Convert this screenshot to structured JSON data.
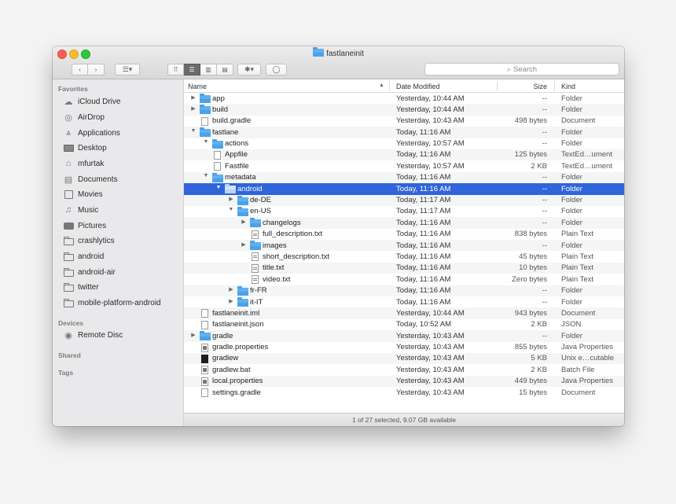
{
  "window": {
    "title": "fastlaneinit"
  },
  "toolbar": {
    "back_label": "‹",
    "forward_label": "›",
    "arrange_label": "☰▾",
    "view_icons_label": "⠿",
    "view_list_label": "☰",
    "view_columns_label": "▥",
    "view_gallery_label": "▤",
    "action_label": "✱▾",
    "tag_label": "◯",
    "search_placeholder": "Search"
  },
  "sidebar": {
    "favorites_header": "Favorites",
    "favorites": [
      {
        "label": "iCloud Drive",
        "icon": "cloud-icon"
      },
      {
        "label": "AirDrop",
        "icon": "airdrop-icon"
      },
      {
        "label": "Applications",
        "icon": "applications-icon"
      },
      {
        "label": "Desktop",
        "icon": "desktop-icon"
      },
      {
        "label": "mfurtak",
        "icon": "home-icon"
      },
      {
        "label": "Documents",
        "icon": "documents-icon"
      },
      {
        "label": "Movies",
        "icon": "movies-icon"
      },
      {
        "label": "Music",
        "icon": "music-icon"
      },
      {
        "label": "Pictures",
        "icon": "pictures-icon"
      },
      {
        "label": "crashlytics",
        "icon": "folder-icon"
      },
      {
        "label": "android",
        "icon": "folder-icon"
      },
      {
        "label": "android-air",
        "icon": "folder-icon"
      },
      {
        "label": "twitter",
        "icon": "folder-icon"
      },
      {
        "label": "mobile-platform-android",
        "icon": "folder-icon"
      }
    ],
    "devices_header": "Devices",
    "devices": [
      {
        "label": "Remote Disc",
        "icon": "disc-icon"
      }
    ],
    "shared_header": "Shared",
    "tags_header": "Tags"
  },
  "columns": {
    "name": "Name",
    "date": "Date Modified",
    "size": "Size",
    "kind": "Kind"
  },
  "rows": [
    {
      "name": "app",
      "date": "Yesterday, 10:44 AM",
      "size": "--",
      "kind": "Folder",
      "depth": 0,
      "type": "folder",
      "disclosure": "closed"
    },
    {
      "name": "build",
      "date": "Yesterday, 10:44 AM",
      "size": "--",
      "kind": "Folder",
      "depth": 0,
      "type": "folder",
      "disclosure": "closed"
    },
    {
      "name": "build.gradle",
      "date": "Yesterday, 10:43 AM",
      "size": "498 bytes",
      "kind": "Document",
      "depth": 0,
      "type": "doc"
    },
    {
      "name": "fastlane",
      "date": "Today, 11:16 AM",
      "size": "--",
      "kind": "Folder",
      "depth": 0,
      "type": "folder",
      "disclosure": "open"
    },
    {
      "name": "actions",
      "date": "Yesterday, 10:57 AM",
      "size": "--",
      "kind": "Folder",
      "depth": 1,
      "type": "folder",
      "disclosure": "open"
    },
    {
      "name": "Appfile",
      "date": "Today, 11:16 AM",
      "size": "125 bytes",
      "kind": "TextEd…ument",
      "depth": 1,
      "type": "doc"
    },
    {
      "name": "Fastfile",
      "date": "Yesterday, 10:57 AM",
      "size": "2 KB",
      "kind": "TextEd…ument",
      "depth": 1,
      "type": "doc"
    },
    {
      "name": "metadata",
      "date": "Today, 11:16 AM",
      "size": "--",
      "kind": "Folder",
      "depth": 1,
      "type": "folder",
      "disclosure": "open"
    },
    {
      "name": "android",
      "date": "Today, 11:16 AM",
      "size": "--",
      "kind": "Folder",
      "depth": 2,
      "type": "folder",
      "disclosure": "open",
      "selected": true
    },
    {
      "name": "de-DE",
      "date": "Today, 11:17 AM",
      "size": "--",
      "kind": "Folder",
      "depth": 3,
      "type": "folder",
      "disclosure": "closed"
    },
    {
      "name": "en-US",
      "date": "Today, 11:17 AM",
      "size": "--",
      "kind": "Folder",
      "depth": 3,
      "type": "folder",
      "disclosure": "open"
    },
    {
      "name": "changelogs",
      "date": "Today, 11:16 AM",
      "size": "--",
      "kind": "Folder",
      "depth": 4,
      "type": "folder",
      "disclosure": "closed"
    },
    {
      "name": "full_description.txt",
      "date": "Today, 11:16 AM",
      "size": "838 bytes",
      "kind": "Plain Text",
      "depth": 4,
      "type": "txt"
    },
    {
      "name": "images",
      "date": "Today, 11:16 AM",
      "size": "--",
      "kind": "Folder",
      "depth": 4,
      "type": "folder",
      "disclosure": "closed"
    },
    {
      "name": "short_description.txt",
      "date": "Today, 11:16 AM",
      "size": "45 bytes",
      "kind": "Plain Text",
      "depth": 4,
      "type": "txt"
    },
    {
      "name": "title.txt",
      "date": "Today, 11:16 AM",
      "size": "10 bytes",
      "kind": "Plain Text",
      "depth": 4,
      "type": "txt"
    },
    {
      "name": "video.txt",
      "date": "Today, 11:16 AM",
      "size": "Zero bytes",
      "kind": "Plain Text",
      "depth": 4,
      "type": "txt"
    },
    {
      "name": "fr-FR",
      "date": "Today, 11:16 AM",
      "size": "--",
      "kind": "Folder",
      "depth": 3,
      "type": "folder",
      "disclosure": "closed"
    },
    {
      "name": "it-IT",
      "date": "Today, 11:16 AM",
      "size": "--",
      "kind": "Folder",
      "depth": 3,
      "type": "folder",
      "disclosure": "closed"
    },
    {
      "name": "fastlaneinit.iml",
      "date": "Yesterday, 10:44 AM",
      "size": "943 bytes",
      "kind": "Document",
      "depth": 0,
      "type": "doc"
    },
    {
      "name": "fastlaneinit.json",
      "date": "Today, 10:52 AM",
      "size": "2 KB",
      "kind": "JSON",
      "depth": 0,
      "type": "doc"
    },
    {
      "name": "gradle",
      "date": "Yesterday, 10:43 AM",
      "size": "--",
      "kind": "Folder",
      "depth": 0,
      "type": "folder",
      "disclosure": "closed"
    },
    {
      "name": "gradle.properties",
      "date": "Yesterday, 10:43 AM",
      "size": "855 bytes",
      "kind": "Java Properties",
      "depth": 0,
      "type": "props"
    },
    {
      "name": "gradlew",
      "date": "Yesterday, 10:43 AM",
      "size": "5 KB",
      "kind": "Unix e…cutable",
      "depth": 0,
      "type": "exec"
    },
    {
      "name": "gradlew.bat",
      "date": "Yesterday, 10:43 AM",
      "size": "2 KB",
      "kind": "Batch File",
      "depth": 0,
      "type": "props"
    },
    {
      "name": "local.properties",
      "date": "Yesterday, 10:43 AM",
      "size": "449 bytes",
      "kind": "Java Properties",
      "depth": 0,
      "type": "props"
    },
    {
      "name": "settings.gradle",
      "date": "Yesterday, 10:43 AM",
      "size": "15 bytes",
      "kind": "Document",
      "depth": 0,
      "type": "doc"
    }
  ],
  "status": {
    "text": "1 of 27 selected, 9.07 GB available"
  },
  "colors": {
    "selection": "#2f65d9",
    "folder": "#5fb0f0"
  }
}
